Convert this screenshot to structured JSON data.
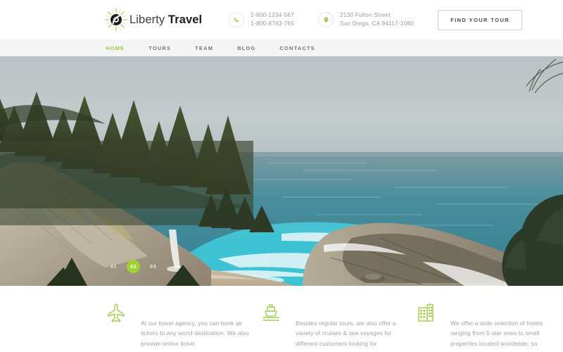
{
  "colors": {
    "accent_green": "#9ac93e",
    "dot_active_green": "#9ed132",
    "nav_bar_bg": "#f4f5f4",
    "body_text": "#a2a2a2",
    "brand_dark": "#1d1d1d"
  },
  "header": {
    "brand": {
      "logo_icon": "compass-sunburst-icon",
      "name_light": "Liberty",
      "name_bold": "Travel"
    },
    "phone": {
      "icon": "phone-icon",
      "line1": "1-800-1234-567",
      "line2": "1-800-8763-765"
    },
    "address": {
      "icon": "map-pin-icon",
      "line1": "2130 Fulton Street",
      "line2": "San Diego, CA 94117-1080"
    },
    "cta_label": "FIND YOUR TOUR"
  },
  "nav": {
    "items": [
      {
        "label": "HOME",
        "active": true
      },
      {
        "label": "TOURS",
        "active": false
      },
      {
        "label": "TEAM",
        "active": false
      },
      {
        "label": "BLOG",
        "active": false
      },
      {
        "label": "CONTACTS",
        "active": false
      }
    ]
  },
  "hero": {
    "alt": "Coastal cove with turquoise water, sandy beach, rocky cliffs and pine trees",
    "slider_dots": [
      {
        "label": "01",
        "active": false
      },
      {
        "label": "02",
        "active": true
      },
      {
        "label": "03",
        "active": false
      }
    ]
  },
  "features": [
    {
      "icon": "airplane-icon",
      "text": "At our travel agency, you can book air tickets to any world destination. We also provide online ticket"
    },
    {
      "icon": "ship-icon",
      "text": "Besides regular tours, we also offer a variety of cruises & sea voyages for different customers looking for"
    },
    {
      "icon": "hotel-building-icon",
      "text": "We offer a wide selection of hotels ranging from 5-star ones to small properties located worldwide, so"
    }
  ]
}
